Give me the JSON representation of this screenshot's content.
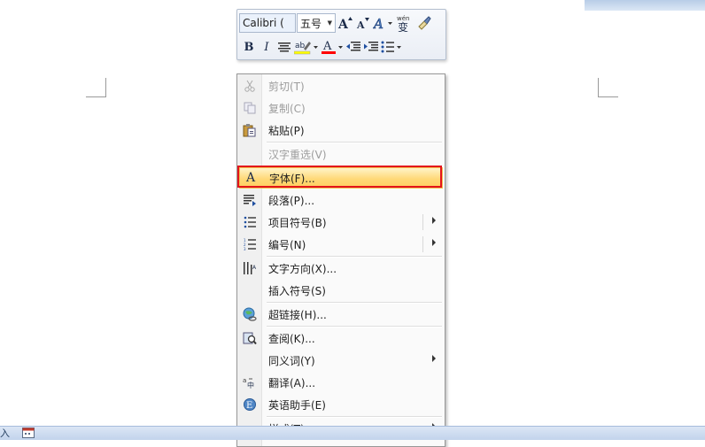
{
  "mini_toolbar": {
    "font_name": "Calibri (",
    "font_size": "五号",
    "wen_label": "wén",
    "bian_label": "变"
  },
  "context_menu": {
    "items": [
      {
        "label": "剪切(T)",
        "icon": "scissors-icon",
        "disabled": true
      },
      {
        "label": "复制(C)",
        "icon": "copy-icon",
        "disabled": true
      },
      {
        "label": "粘贴(P)",
        "icon": "paste-icon",
        "disabled": false
      },
      {
        "label": "汉字重选(V)",
        "icon": "",
        "disabled": true
      },
      {
        "label": "字体(F)...",
        "icon": "font-icon",
        "disabled": false,
        "highlighted": true
      },
      {
        "label": "段落(P)...",
        "icon": "paragraph-icon",
        "disabled": false
      },
      {
        "label": "项目符号(B)",
        "icon": "bullets-icon",
        "disabled": false,
        "submenu": true
      },
      {
        "label": "编号(N)",
        "icon": "numbering-icon",
        "disabled": false,
        "submenu": true
      },
      {
        "label": "文字方向(X)...",
        "icon": "text-direction-icon",
        "disabled": false
      },
      {
        "label": "插入符号(S)",
        "icon": "",
        "disabled": false
      },
      {
        "label": "超链接(H)...",
        "icon": "hyperlink-icon",
        "disabled": false
      },
      {
        "label": "查阅(K)...",
        "icon": "research-icon",
        "disabled": false
      },
      {
        "label": "同义词(Y)",
        "icon": "",
        "disabled": false,
        "submenu": true
      },
      {
        "label": "翻译(A)...",
        "icon": "translate-icon",
        "disabled": false
      },
      {
        "label": "英语助手(E)",
        "icon": "english-assistant-icon",
        "disabled": false
      },
      {
        "label": "样式(T)",
        "icon": "",
        "disabled": false,
        "submenu": true
      }
    ]
  },
  "status_bar": {
    "left_text": "入"
  },
  "colors": {
    "highlight_top": "#fff3c8",
    "highlight_bottom": "#ffcf5f",
    "red_frame": "#e3141b",
    "font_color_bar": "#ff0000",
    "highlight_color_bar": "#ffff00"
  }
}
